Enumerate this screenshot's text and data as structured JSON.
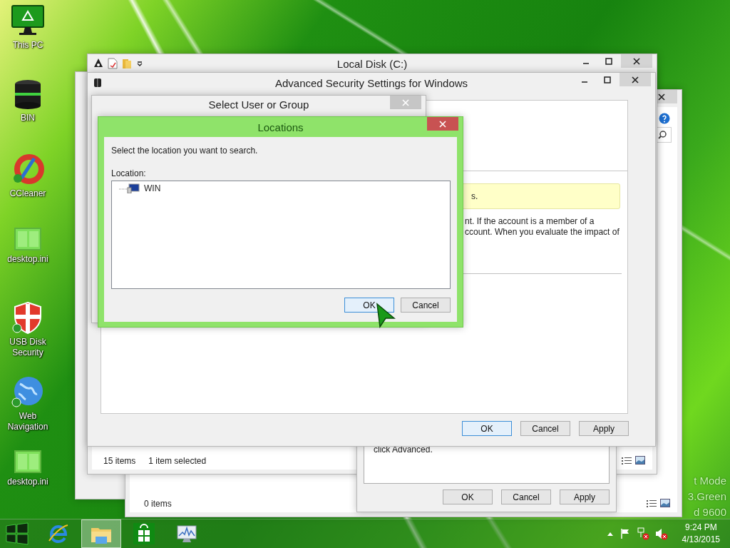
{
  "desktop_icons": [
    {
      "kind": "monitor",
      "label": "This PC"
    },
    {
      "kind": "bin",
      "label": "BIN"
    },
    {
      "kind": "cleaner",
      "label": "CCleaner"
    },
    {
      "kind": "file",
      "label": "desktop.ini"
    },
    {
      "kind": "shield",
      "label": "USB Disk Security"
    },
    {
      "kind": "globe",
      "label": "Web Navigation"
    },
    {
      "kind": "file",
      "label": "desktop.ini"
    }
  ],
  "desktop_text": [
    "t Mode",
    "3.Green",
    "d 9600"
  ],
  "back_window": {
    "status": "0 items"
  },
  "local_disk": {
    "title": "Local Disk (C:)",
    "status": [
      "15 items",
      "1 item selected"
    ]
  },
  "properties": {
    "text": "click Advanced.",
    "buttons": [
      {
        "label": "OK",
        "default": false
      },
      {
        "label": "Cancel",
        "default": false
      },
      {
        "label": "Apply",
        "default": false
      }
    ]
  },
  "advanced_security": {
    "title": "Advanced Security Settings for Windows",
    "notice": "s.",
    "text_lines": [
      "nt. If the account is a member of a",
      "ccount. When you evaluate the impact of"
    ],
    "buttons": [
      {
        "label": "OK",
        "default": true
      },
      {
        "label": "Cancel",
        "default": false
      },
      {
        "label": "Apply",
        "default": false
      }
    ]
  },
  "select_user": {
    "title": "Select User or Group"
  },
  "locations": {
    "title": "Locations",
    "instruction": "Select the location you want to search.",
    "field_label": "Location:",
    "tree": [
      {
        "label": "WIN",
        "selected": false
      }
    ],
    "buttons": [
      {
        "label": "OK",
        "default": true
      },
      {
        "label": "Cancel",
        "default": false
      }
    ]
  },
  "taskbar": {
    "apps": [
      {
        "kind": "browser",
        "active": false
      },
      {
        "kind": "folder",
        "active": true
      },
      {
        "kind": "store",
        "active": false
      },
      {
        "kind": "monitor",
        "active": false
      }
    ],
    "clock": {
      "time": "9:24 PM",
      "date": "4/13/2015"
    }
  }
}
